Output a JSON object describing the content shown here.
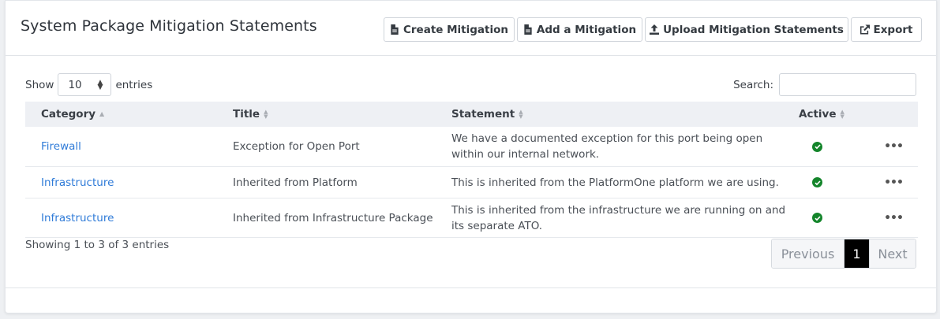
{
  "header": {
    "title": "System Package Mitigation Statements",
    "buttons": [
      {
        "label": "Create Mitigation",
        "icon": "file-icon"
      },
      {
        "label": "Add a Mitigation",
        "icon": "file-icon"
      },
      {
        "label": "Upload Mitigation Statements",
        "icon": "upload-icon"
      },
      {
        "label": "Export",
        "icon": "external-link-icon"
      }
    ]
  },
  "controls": {
    "show_label": "Show",
    "entries_value": "10",
    "entries_label": "entries",
    "search_label": "Search:",
    "search_value": ""
  },
  "table": {
    "columns": [
      "Category",
      "Title",
      "Statement",
      "Active"
    ],
    "rows": [
      {
        "category": "Firewall",
        "title": "Exception for Open Port",
        "statement": "We have a documented exception for this port being open within our internal network.",
        "active": true
      },
      {
        "category": "Infrastructure",
        "title": "Inherited from Platform",
        "statement": "This is inherited from the PlatformOne platform we are using.",
        "active": true
      },
      {
        "category": "Infrastructure",
        "title": "Inherited from Infrastructure Package",
        "statement": "This is inherited from the infrastructure we are running on and its separate ATO.",
        "active": true
      }
    ]
  },
  "footer": {
    "info": "Showing 1 to 3 of 3 entries",
    "previous": "Previous",
    "current_page": "1",
    "next": "Next"
  },
  "colors": {
    "link": "#2f7bd8",
    "active_check": "#14852b",
    "pager_active_bg": "#000000"
  }
}
